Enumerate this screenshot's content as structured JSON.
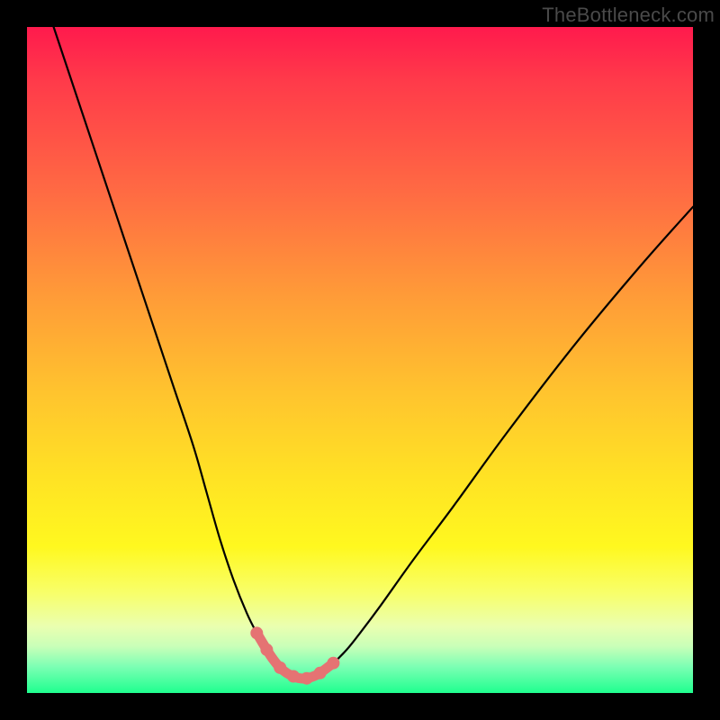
{
  "watermark": "TheBottleneck.com",
  "chart_data": {
    "type": "line",
    "title": "",
    "xlabel": "",
    "ylabel": "",
    "xlim": [
      0,
      100
    ],
    "ylim": [
      0,
      100
    ],
    "grid": false,
    "legend": false,
    "series": [
      {
        "name": "bottleneck-curve",
        "color": "#000000",
        "x": [
          4,
          7,
          10,
          13,
          16,
          19,
          22,
          25,
          27,
          29,
          31,
          33,
          34.5,
          36,
          37,
          38,
          39,
          40,
          41,
          42,
          43,
          44,
          46,
          48,
          50,
          53,
          58,
          64,
          72,
          82,
          92,
          100
        ],
        "y": [
          100,
          91,
          82,
          73,
          64,
          55,
          46,
          37,
          30,
          23,
          17,
          12,
          9,
          6.5,
          5,
          3.8,
          3,
          2.5,
          2.2,
          2.2,
          2.5,
          3,
          4.5,
          6.5,
          9,
          13,
          20,
          28,
          39,
          52,
          64,
          73
        ]
      },
      {
        "name": "bottleneck-highlight",
        "color": "#e57373",
        "x": [
          34.5,
          36,
          37,
          38,
          39,
          40,
          41,
          42,
          43,
          44,
          46
        ],
        "y": [
          9,
          6.5,
          5,
          3.8,
          3,
          2.5,
          2.2,
          2.2,
          2.5,
          3,
          4.5
        ]
      }
    ],
    "markers": {
      "name": "bottleneck-marker-dots",
      "color": "#e57373",
      "x": [
        34.5,
        36,
        38,
        40,
        42,
        44,
        46
      ],
      "y": [
        9,
        6.5,
        3.8,
        2.5,
        2.2,
        3,
        4.5
      ]
    }
  }
}
